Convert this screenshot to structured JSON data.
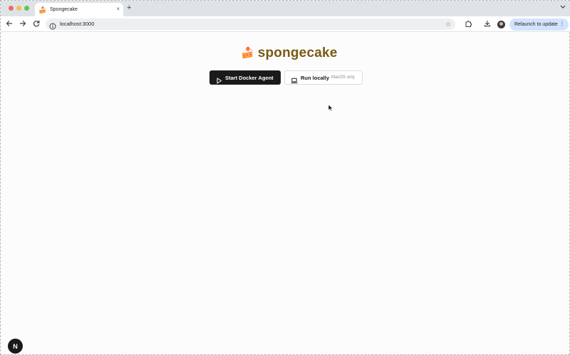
{
  "browser": {
    "tab": {
      "favicon": "cake-slice-emoji",
      "title": "Spongecake",
      "close_glyph": "×"
    },
    "new_tab_glyph": "+",
    "tab_menu_glyph": "⌄",
    "url": "localhost:3000",
    "relaunch_label": "Relaunch to update",
    "menu_glyph": "⋮",
    "star_glyph": "☆"
  },
  "page": {
    "brand": {
      "emoji": "🍰",
      "name": "spongecake"
    },
    "buttons": {
      "docker_label": "Start Docker Agent",
      "local_label": "Run locally",
      "local_note": "MacOS only"
    },
    "next_badge": "N"
  },
  "colors": {
    "brand_text": "#7a5a14",
    "primary_button": "#1a1a1a",
    "relaunch_bg": "#d3e3fd",
    "tabstrip_bg": "#dfe3e8"
  }
}
